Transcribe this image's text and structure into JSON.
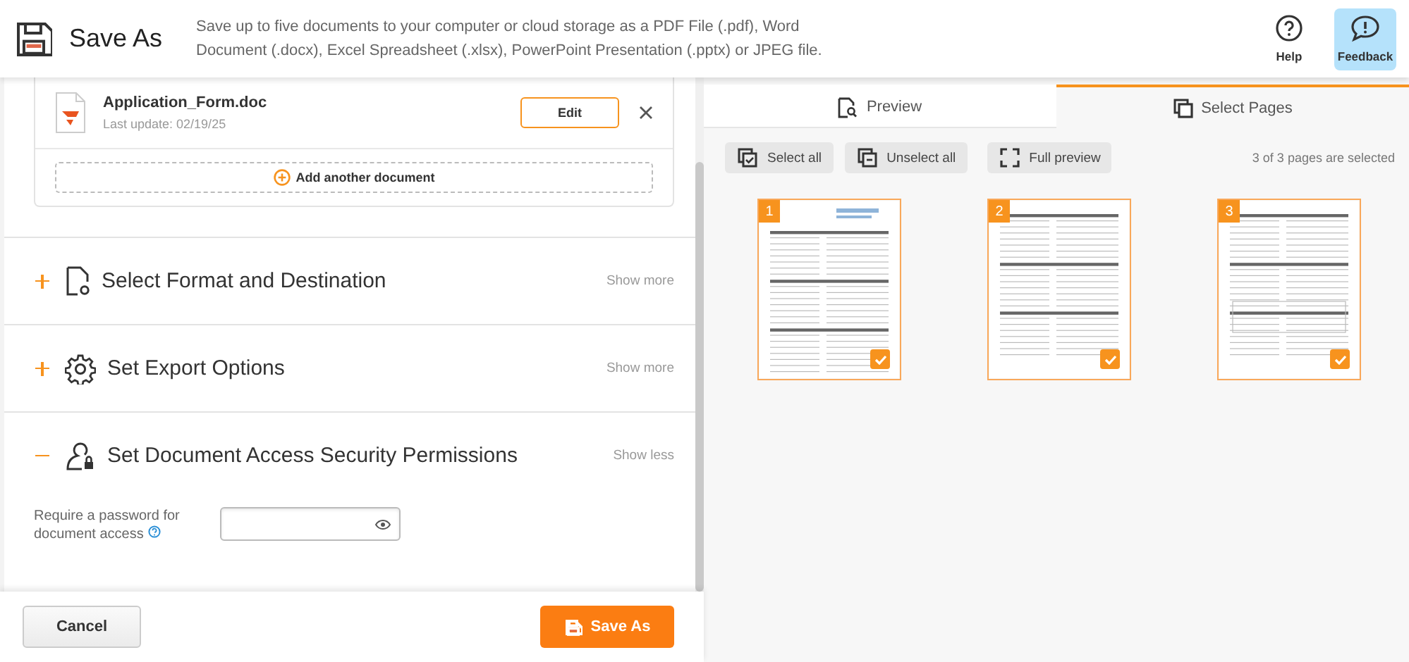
{
  "header": {
    "title": "Save As",
    "description": "Save up to five documents to your computer or cloud storage as a PDF File (.pdf), Word Document (.docx), Excel Spreadsheet (.xlsx), PowerPoint Presentation (.pptx) or JPEG file.",
    "buttons": [
      {
        "kind": "help",
        "label": "Help",
        "selected": false
      },
      {
        "kind": "feedback",
        "label": "Feedback",
        "selected": true
      }
    ]
  },
  "document": {
    "name": "Application_Form.doc",
    "updated": "Last update: 02/19/25",
    "edit": "Edit",
    "add": "Add another document"
  },
  "sections": [
    {
      "kind": "format",
      "title": "Select Format and Destination",
      "toggle": "Show more",
      "expanded": false
    },
    {
      "kind": "export",
      "title": "Set Export Options",
      "toggle": "Show more",
      "expanded": false
    },
    {
      "kind": "security",
      "title": "Set Document Access Security Permissions",
      "toggle": "Show less",
      "expanded": true
    }
  ],
  "password": {
    "label": "Require a password for document access"
  },
  "footer": {
    "cancel": "Cancel",
    "save": "Save As"
  },
  "tabs": [
    {
      "kind": "preview",
      "label": "Preview",
      "selected": false
    },
    {
      "kind": "pages",
      "label": "Select Pages",
      "selected": true
    }
  ],
  "toolbar": [
    {
      "kind": "select",
      "label": "Select all"
    },
    {
      "kind": "unselect",
      "label": "Unselect all"
    },
    {
      "kind": "full",
      "label": "Full preview"
    }
  ],
  "selection_status": "3 of 3 pages are selected",
  "pages": [
    {
      "number": "1",
      "checked": true
    },
    {
      "number": "2",
      "checked": true
    },
    {
      "number": "3",
      "checked": true
    }
  ]
}
